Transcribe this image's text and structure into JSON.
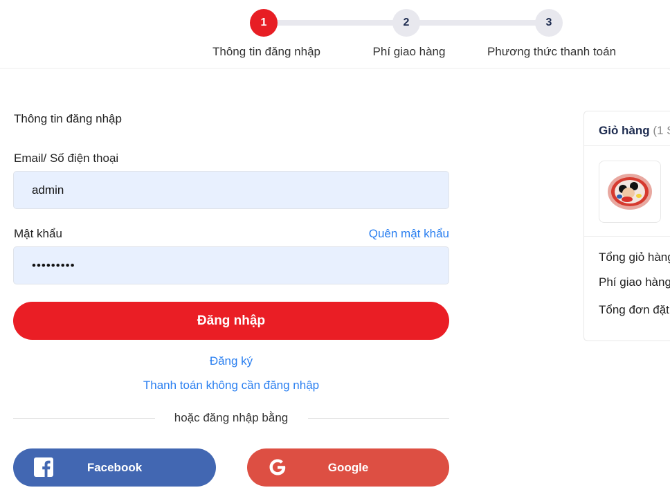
{
  "stepper": {
    "steps": [
      {
        "number": "1",
        "label": "Thông tin đăng nhập"
      },
      {
        "number": "2",
        "label": "Phí giao hàng"
      },
      {
        "number": "3",
        "label": "Phương thức thanh toán"
      }
    ]
  },
  "login": {
    "section_title": "Thông tin đăng nhập",
    "email_label": "Email/ Số điện thoại",
    "email_value": "admin",
    "password_label": "Mật khẩu",
    "password_value": "•••••••••",
    "forgot_link": "Quên mật khẩu",
    "login_button": "Đăng nhập",
    "register_link": "Đăng ký",
    "guest_checkout_link": "Thanh toán không cần đăng nhập",
    "divider_text": "hoặc đăng nhập bằng",
    "facebook_button": "Facebook",
    "google_button": "Google"
  },
  "cart": {
    "title": "Giỏ hàng",
    "count_text": "(1 S",
    "total_cart_label": "Tổng giỏ hàng",
    "shipping_fee_label": "Phí giao hàng",
    "total_order_label": "Tổng đơn đặt"
  },
  "colors": {
    "primary_red": "#e71e24",
    "link_blue": "#2a7ff0",
    "facebook_blue": "#4267b2",
    "google_red": "#dd4f43",
    "input_bg": "#e8f0fe"
  },
  "icons": {
    "facebook": "facebook-icon",
    "google": "google-icon"
  }
}
